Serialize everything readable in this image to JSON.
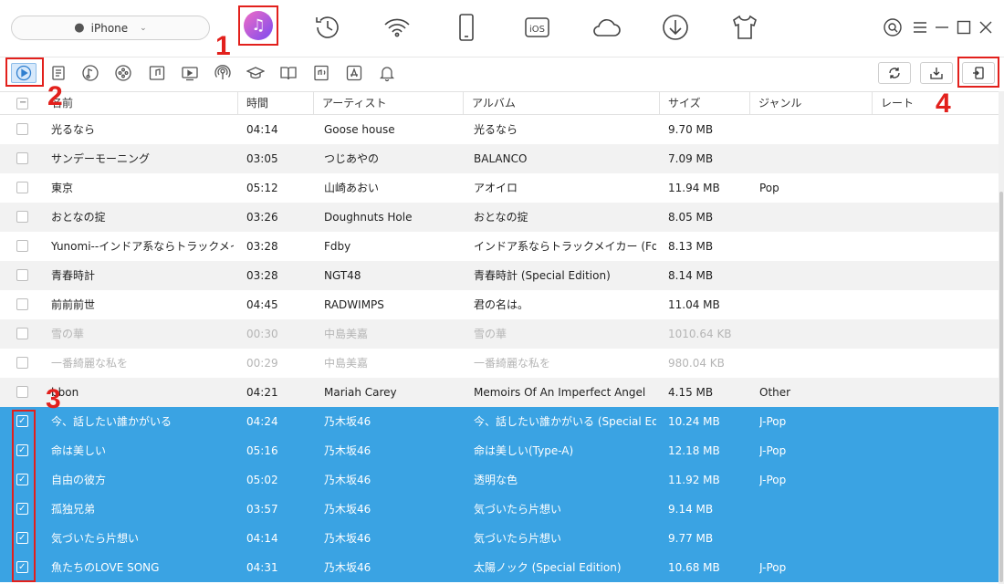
{
  "device": {
    "name": "iPhone"
  },
  "top_icons": [
    "music-icon",
    "history-icon",
    "airbackup-icon",
    "phone-icon",
    "ios-icon",
    "icloud-icon",
    "download-icon",
    "shirt-icon"
  ],
  "categories": [
    "music",
    "playlist",
    "ringtone",
    "voicememo",
    "musicvideo",
    "tvshow",
    "podcast",
    "itunesu",
    "book",
    "audiobook",
    "app",
    "alert"
  ],
  "annotations": {
    "n1": "1",
    "n2": "2",
    "n3": "3",
    "n4": "4"
  },
  "columns": {
    "name": "名前",
    "time": "時間",
    "artist": "アーティスト",
    "album": "アルバム",
    "size": "サイズ",
    "genre": "ジャンル",
    "rate": "レート"
  },
  "rows": [
    {
      "name": "光るなら",
      "time": "04:14",
      "artist": "Goose house",
      "album": "光るなら",
      "size": "9.70 MB",
      "genre": "",
      "state": "normal"
    },
    {
      "name": "サンデーモーニング",
      "time": "03:05",
      "artist": "つじあやの",
      "album": "BALANCO",
      "size": "7.09 MB",
      "genre": "",
      "state": "normal"
    },
    {
      "name": "東京",
      "time": "05:12",
      "artist": "山崎あおい",
      "album": "アオイロ",
      "size": "11.94 MB",
      "genre": "Pop",
      "state": "normal"
    },
    {
      "name": "おとなの掟",
      "time": "03:26",
      "artist": "Doughnuts Hole",
      "album": "おとなの掟",
      "size": "8.05 MB",
      "genre": "",
      "state": "normal"
    },
    {
      "name": "Yunomi--インドア系ならトラックメイカー...",
      "time": "03:28",
      "artist": "Fdby",
      "album": "インドア系ならトラックメイカー (Fdby Re...",
      "size": "8.13 MB",
      "genre": "",
      "state": "normal"
    },
    {
      "name": "青春時計",
      "time": "03:28",
      "artist": "NGT48",
      "album": "青春時計 (Special Edition)",
      "size": "8.14 MB",
      "genre": "",
      "state": "normal"
    },
    {
      "name": "前前前世",
      "time": "04:45",
      "artist": "RADWIMPS",
      "album": "君の名は。",
      "size": "11.04 MB",
      "genre": "",
      "state": "normal"
    },
    {
      "name": "雪の華",
      "time": "00:30",
      "artist": "中島美嘉",
      "album": "雪の華",
      "size": "1010.64 KB",
      "genre": "",
      "state": "dim"
    },
    {
      "name": "一番綺麗な私を",
      "time": "00:29",
      "artist": "中島美嘉",
      "album": "一番綺麗な私を",
      "size": "980.04 KB",
      "genre": "",
      "state": "dim"
    },
    {
      "name": "bbon",
      "time": "04:21",
      "artist": "Mariah Carey",
      "album": "Memoirs Of An Imperfect Angel",
      "size": "4.15 MB",
      "genre": "Other",
      "state": "normal"
    },
    {
      "name": "今、話したい誰かがいる",
      "time": "04:24",
      "artist": "乃木坂46",
      "album": "今、話したい誰かがいる (Special Editi...",
      "size": "10.24 MB",
      "genre": "J-Pop",
      "state": "sel"
    },
    {
      "name": "命は美しい",
      "time": "05:16",
      "artist": "乃木坂46",
      "album": "命は美しい(Type-A)",
      "size": "12.18 MB",
      "genre": "J-Pop",
      "state": "sel"
    },
    {
      "name": "自由の彼方",
      "time": "05:02",
      "artist": "乃木坂46",
      "album": "透明な色",
      "size": "11.92 MB",
      "genre": "J-Pop",
      "state": "sel"
    },
    {
      "name": "孤独兄弟",
      "time": "03:57",
      "artist": "乃木坂46",
      "album": "気づいたら片想い",
      "size": "9.14 MB",
      "genre": "",
      "state": "sel"
    },
    {
      "name": "気づいたら片想い",
      "time": "04:14",
      "artist": "乃木坂46",
      "album": "気づいたら片想い",
      "size": "9.77 MB",
      "genre": "",
      "state": "sel"
    },
    {
      "name": "魚たちのLOVE SONG",
      "time": "04:31",
      "artist": "乃木坂46",
      "album": "太陽ノック (Special Edition)",
      "size": "10.68 MB",
      "genre": "J-Pop",
      "state": "sel"
    }
  ]
}
